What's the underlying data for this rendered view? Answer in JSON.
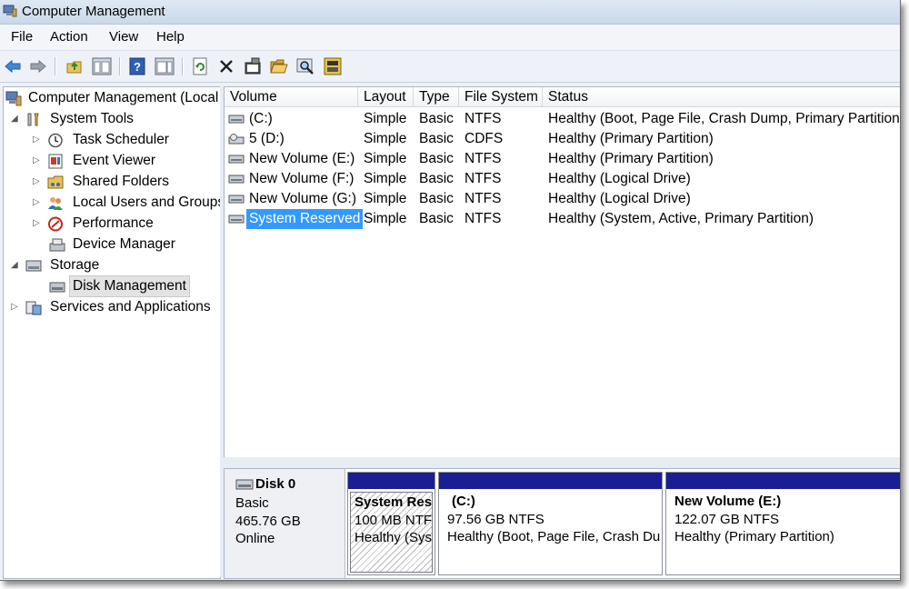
{
  "window": {
    "title": "Computer Management"
  },
  "menu": [
    "File",
    "Action",
    "View",
    "Help"
  ],
  "toolbar": [
    {
      "name": "back-icon",
      "icon": "arrow-left"
    },
    {
      "name": "forward-icon",
      "icon": "arrow-right"
    },
    {
      "name": "up-folder-icon",
      "icon": "folder-up"
    },
    {
      "name": "show-hide-console-tree-icon",
      "icon": "console-tree"
    },
    {
      "name": "help-icon",
      "icon": "help"
    },
    {
      "name": "show-hide-action-pane-icon",
      "icon": "action-pane"
    },
    {
      "name": "refresh-icon",
      "icon": "refresh"
    },
    {
      "name": "delete-icon",
      "icon": "x"
    },
    {
      "name": "properties-icon",
      "icon": "properties"
    },
    {
      "name": "open-icon",
      "icon": "folder-open"
    },
    {
      "name": "search-icon",
      "icon": "magnifier"
    },
    {
      "name": "settings-icon",
      "icon": "settings"
    }
  ],
  "tree": {
    "root": "Computer Management (Local",
    "system_tools": "System Tools",
    "task_scheduler": "Task Scheduler",
    "event_viewer": "Event Viewer",
    "shared_folders": "Shared Folders",
    "local_users": "Local Users and Groups",
    "performance": "Performance",
    "device_manager": "Device Manager",
    "storage": "Storage",
    "disk_management": "Disk Management",
    "services": "Services and Applications"
  },
  "volumes": {
    "columns": [
      "Volume",
      "Layout",
      "Type",
      "File System",
      "Status"
    ],
    "rows": [
      {
        "volume": "(C:)",
        "layout": "Simple",
        "type": "Basic",
        "fs": "NTFS",
        "status": "Healthy (Boot, Page File, Crash Dump, Primary Partition)"
      },
      {
        "volume": "5 (D:)",
        "layout": "Simple",
        "type": "Basic",
        "fs": "CDFS",
        "status": "Healthy (Primary Partition)"
      },
      {
        "volume": "New Volume (E:)",
        "layout": "Simple",
        "type": "Basic",
        "fs": "NTFS",
        "status": "Healthy (Primary Partition)"
      },
      {
        "volume": "New Volume (F:)",
        "layout": "Simple",
        "type": "Basic",
        "fs": "NTFS",
        "status": "Healthy (Logical Drive)"
      },
      {
        "volume": "New Volume (G:)",
        "layout": "Simple",
        "type": "Basic",
        "fs": "NTFS",
        "status": "Healthy (Logical Drive)"
      },
      {
        "volume": "System Reserved",
        "layout": "Simple",
        "type": "Basic",
        "fs": "NTFS",
        "status": "Healthy (System, Active, Primary Partition)"
      }
    ]
  },
  "disk": {
    "name": "Disk 0",
    "type": "Basic",
    "size": "465.76 GB",
    "state": "Online",
    "partitions": [
      {
        "title": "System Res",
        "size": "100 MB NTF",
        "status": "Healthy (Sys"
      },
      {
        "title": "(C:)",
        "size": "97.56 GB NTFS",
        "status": "Healthy (Boot, Page File, Crash Du"
      },
      {
        "title": "New Volume  (E:)",
        "size": "122.07 GB NTFS",
        "status": "Healthy (Primary Partition)"
      }
    ]
  },
  "colors": {
    "partition_bar": "#1a1e93",
    "selection": "#3399ff"
  }
}
